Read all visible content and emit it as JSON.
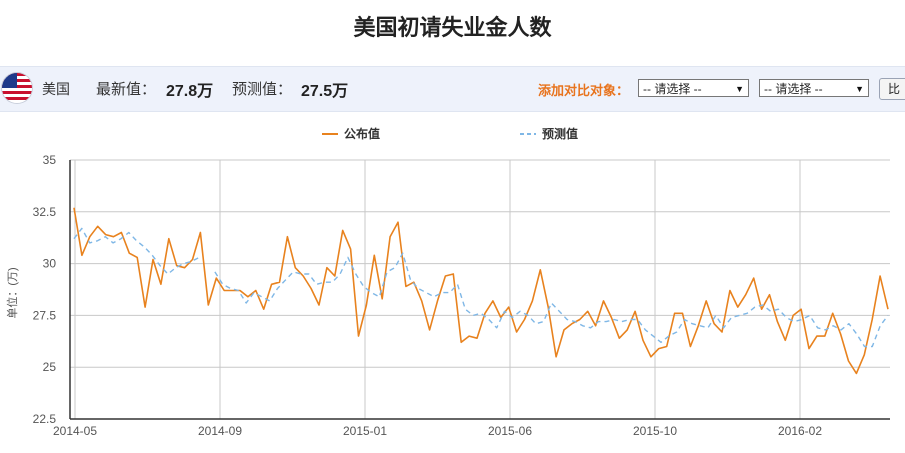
{
  "page": {
    "title": "美国初请失业金人数"
  },
  "info_bar": {
    "country": "美国",
    "latest_label": "最新值：",
    "latest_value": "27.8万",
    "forecast_label": "预测值：",
    "forecast_value": "27.5万",
    "compare_label": "添加对比对象：",
    "select1_value": "-- 请选择 --",
    "select2_value": "-- 请选择 --",
    "compare_button": "比"
  },
  "colors": {
    "actual": "#e8821e",
    "forecast": "#7fb7e6",
    "grid": "#c8c8c8",
    "accent": "#e8741e"
  },
  "chart_data": {
    "type": "line",
    "ylabel": "单位：(万)",
    "xlabel": "",
    "ylim": [
      22.5,
      35
    ],
    "yticks": [
      "22.5",
      "25",
      "27.5",
      "30",
      "32.5",
      "35"
    ],
    "xticks": [
      "2014-05",
      "2014-09",
      "2015-01",
      "2015-06",
      "2015-10",
      "2016-02"
    ],
    "legend_position": "top",
    "grid": true,
    "series": [
      {
        "name": "公布值",
        "style": "solid",
        "values": [
          32.7,
          30.4,
          31.3,
          31.8,
          31.4,
          31.3,
          31.5,
          30.5,
          30.3,
          27.9,
          30.2,
          29.0,
          31.2,
          29.9,
          29.8,
          30.2,
          31.5,
          28.0,
          29.3,
          28.7,
          28.7,
          28.7,
          28.4,
          28.7,
          27.8,
          29.0,
          29.1,
          31.3,
          29.8,
          29.4,
          28.8,
          28.0,
          29.8,
          29.4,
          31.6,
          30.7,
          26.5,
          28.0,
          30.4,
          28.3,
          31.3,
          32.0,
          28.9,
          29.1,
          28.2,
          26.8,
          28.2,
          29.4,
          29.5,
          26.2,
          26.5,
          26.4,
          27.6,
          28.2,
          27.4,
          27.9,
          26.7,
          27.3,
          28.2,
          29.7,
          27.9,
          25.5,
          26.8,
          27.1,
          27.3,
          27.7,
          27.0,
          28.2,
          27.4,
          26.4,
          26.8,
          27.7,
          26.3,
          25.5,
          25.9,
          26.0,
          27.6,
          27.6,
          26.0,
          27.0,
          28.2,
          27.1,
          26.7,
          28.7,
          27.9,
          28.5,
          29.3,
          27.8,
          28.5,
          27.2,
          26.3,
          27.5,
          27.8,
          25.9,
          26.5,
          26.5,
          27.6,
          26.6,
          25.3,
          24.7,
          25.6,
          27.3,
          29.4,
          27.8
        ]
      },
      {
        "name": "预测值",
        "style": "dashed",
        "values": [
          31.2,
          31.7,
          31.0,
          31.1,
          31.3,
          31.0,
          31.2,
          31.5,
          31.1,
          30.8,
          30.4,
          29.9,
          29.5,
          29.8,
          30.0,
          30.1,
          30.3,
          null,
          29.6,
          29.0,
          28.8,
          28.7,
          28.1,
          28.6,
          28.4,
          28.2,
          28.8,
          29.2,
          29.6,
          29.5,
          29.5,
          29.0,
          29.1,
          29.1,
          29.5,
          30.3,
          29.5,
          28.9,
          28.6,
          28.4,
          29.6,
          29.8,
          30.5,
          29.2,
          28.8,
          28.6,
          28.4,
          28.6,
          28.6,
          29.0,
          27.8,
          27.5,
          27.6,
          27.3,
          26.9,
          27.7,
          27.4,
          27.7,
          27.5,
          27.1,
          27.2,
          28.1,
          27.7,
          27.3,
          27.2,
          27.0,
          26.9,
          27.2,
          27.2,
          27.3,
          27.2,
          27.3,
          27.3,
          26.8,
          26.5,
          26.2,
          26.5,
          26.7,
          27.3,
          27.1,
          27.0,
          26.9,
          27.5,
          26.9,
          27.4,
          27.5,
          27.6,
          27.9,
          28.0,
          27.7,
          27.8,
          27.4,
          27.2,
          27.3,
          27.5,
          26.9,
          26.8,
          27.0,
          26.8,
          27.1,
          26.6,
          26.0,
          26.0,
          27.0,
          27.5
        ]
      }
    ]
  }
}
